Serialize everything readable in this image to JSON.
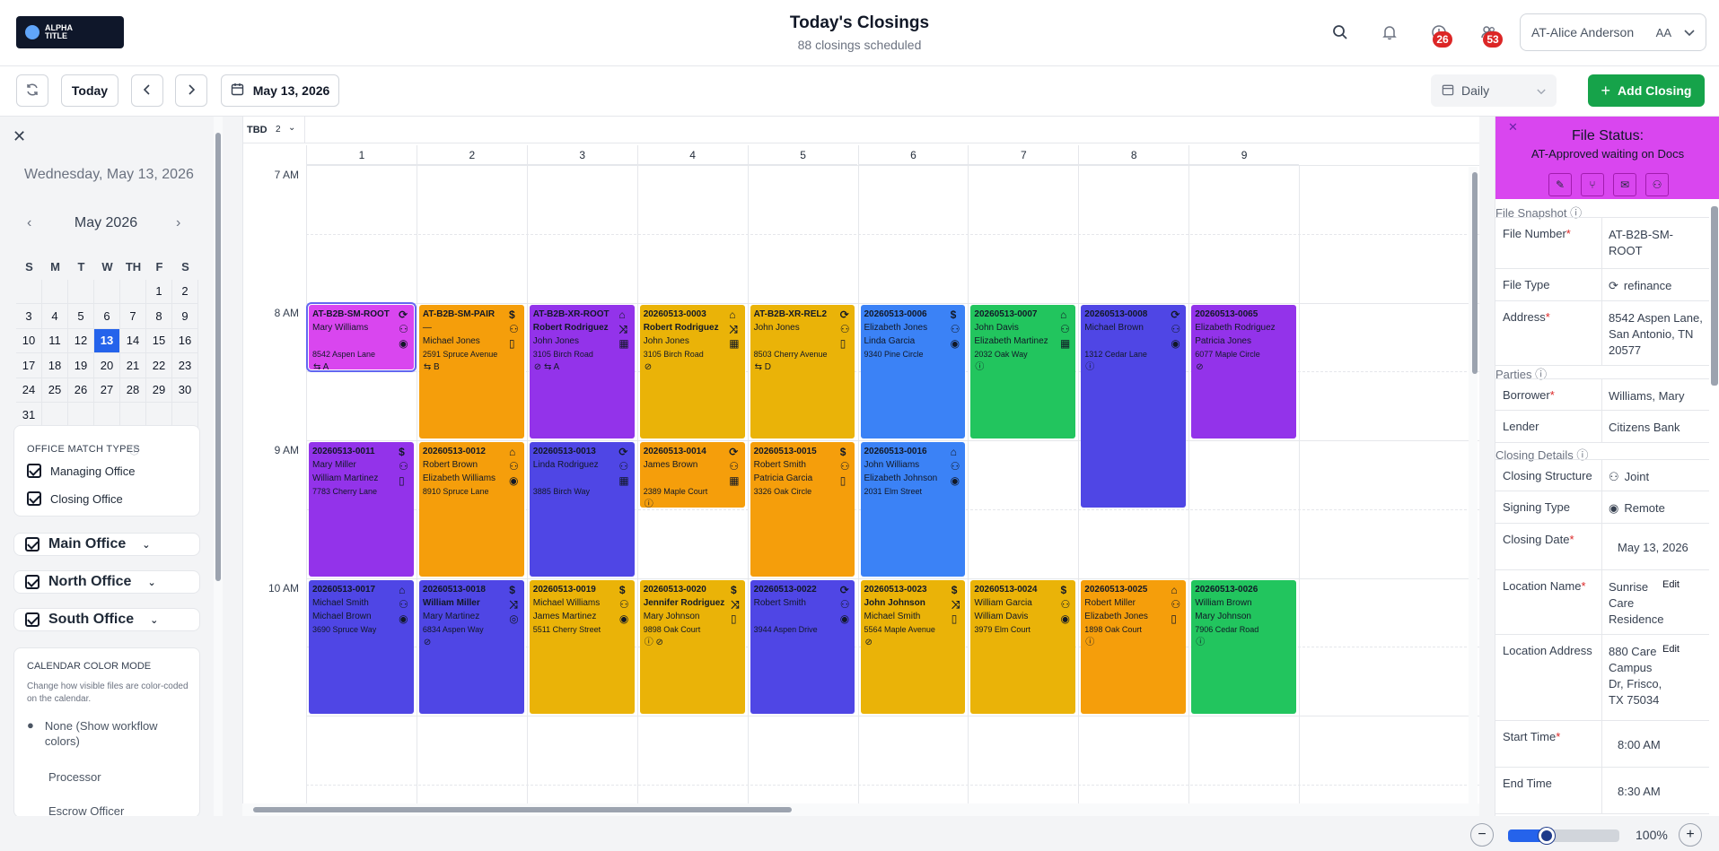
{
  "header": {
    "logo_line1": "ALPHA",
    "logo_line2": "TITLE",
    "title": "Today's Closings",
    "subtitle": "88 closings scheduled",
    "badge_1": "26",
    "badge_2": "53",
    "user_name": "AT-Alice Anderson",
    "user_initials": "AA"
  },
  "toolbar": {
    "today_label": "Today",
    "date_label": "May 13, 2026",
    "view_label": "Daily",
    "add_label": "Add Closing"
  },
  "sidebar": {
    "long_date": "Wednesday, May 13, 2026",
    "month_label": "May 2026",
    "weekdays": [
      "S",
      "M",
      "T",
      "W",
      "TH",
      "F",
      "S"
    ],
    "days": [
      "",
      "",
      "",
      "",
      "",
      "1",
      "2",
      "3",
      "4",
      "5",
      "6",
      "7",
      "8",
      "9",
      "10",
      "11",
      "12",
      "13",
      "14",
      "15",
      "16",
      "17",
      "18",
      "19",
      "20",
      "21",
      "22",
      "23",
      "24",
      "25",
      "26",
      "27",
      "28",
      "29",
      "30",
      "31",
      "",
      "",
      "",
      "",
      "",
      ""
    ],
    "selected_day": "13",
    "match_title": "OFFICE MATCH TYPES",
    "match_1": "Managing Office",
    "match_2": "Closing Office",
    "office_1": "Main Office",
    "office_2": "North Office",
    "office_3": "South Office",
    "color_title": "CALENDAR COLOR MODE",
    "color_desc": "Change how visible files are color-coded on the calendar.",
    "color_opt_1": "None (Show workflow colors)",
    "color_opt_2": "Processor",
    "color_opt_3": "Escrow Officer"
  },
  "calendar": {
    "tbd_label": "TBD",
    "tbd_count": "2",
    "columns": [
      "1",
      "2",
      "3",
      "4",
      "5",
      "6",
      "7",
      "8",
      "9"
    ],
    "times": [
      "7 AM",
      "8 AM",
      "9 AM",
      "10 AM"
    ],
    "events": [
      {
        "col": 0,
        "row": 0,
        "span": 1,
        "color": "#d946ef",
        "selected": true,
        "file": "AT-B2B-SM-ROOT",
        "l1": "Mary Williams",
        "l2": "",
        "addr": "8542 Aspen Lane",
        "foot": "⇆ A",
        "icons": [
          "⟳",
          "⚇",
          "◉"
        ],
        "bold1": false
      },
      {
        "col": 1,
        "row": 0,
        "span": 2,
        "color": "#f59e0b",
        "file": "AT-B2B-SM-PAIR",
        "l1": "—",
        "l2": "Michael Jones",
        "addr": "2591 Spruce Avenue",
        "foot": "⇆ B",
        "icons": [
          "$",
          "⚇",
          "▯"
        ]
      },
      {
        "col": 2,
        "row": 0,
        "span": 2,
        "color": "#9333ea",
        "file": "AT-B2B-XR-ROOT",
        "l1": "Robert Rodriguez",
        "l2": "John Jones",
        "addr": "3105 Birch Road",
        "foot": "⊘ ⇆ A",
        "icons": [
          "⌂",
          "⤨",
          "▦"
        ],
        "bold1": true
      },
      {
        "col": 3,
        "row": 0,
        "span": 2,
        "color": "#eab308",
        "file": "20260513-0003",
        "l1": "Robert Rodriguez",
        "l2": "John Jones",
        "addr": "3105 Birch Road",
        "foot": "⊘",
        "icons": [
          "⌂",
          "⤨",
          "▦"
        ],
        "bold1": true
      },
      {
        "col": 4,
        "row": 0,
        "span": 2,
        "color": "#eab308",
        "file": "AT-B2B-XR-REL2",
        "l1": "John Jones",
        "l2": "",
        "addr": "8503 Cherry Avenue",
        "foot": "⇆ D",
        "icons": [
          "⟳",
          "⚇",
          "▯"
        ]
      },
      {
        "col": 5,
        "row": 0,
        "span": 2,
        "color": "#3b82f6",
        "file": "20260513-0006",
        "l1": "Elizabeth Jones",
        "l2": "Linda Garcia",
        "addr": "9340 Pine Circle",
        "foot": "",
        "icons": [
          "$",
          "⚇",
          "◉"
        ]
      },
      {
        "col": 6,
        "row": 0,
        "span": 2,
        "color": "#22c55e",
        "file": "20260513-0007",
        "l1": "John Davis",
        "l2": "Elizabeth Martinez",
        "addr": "2032 Oak Way",
        "foot": "ⓘ",
        "icons": [
          "⌂",
          "⚇",
          "▦"
        ]
      },
      {
        "col": 7,
        "row": 0,
        "span": 3,
        "color": "#4f46e5",
        "file": "20260513-0008",
        "l1": "Michael Brown",
        "l2": "",
        "addr": "1312 Cedar Lane",
        "foot": "ⓘ",
        "icons": [
          "⟳",
          "⚇",
          "◉"
        ]
      },
      {
        "col": 8,
        "row": 0,
        "span": 2,
        "color": "#9333ea",
        "file": "20260513-0065",
        "l1": "Elizabeth Rodriguez",
        "l2": "Patricia Jones",
        "addr": "6077 Maple Circle",
        "foot": "⊘",
        "icons": []
      },
      {
        "col": 0,
        "row": 1,
        "span": 2,
        "color": "#9333ea",
        "file": "20260513-0011",
        "l1": "Mary Miller",
        "l2": "William Martinez",
        "addr": "7783 Cherry Lane",
        "foot": "",
        "icons": [
          "$",
          "⚇",
          "▯"
        ]
      },
      {
        "col": 1,
        "row": 1,
        "span": 2,
        "color": "#f59e0b",
        "file": "20260513-0012",
        "l1": "Robert Brown",
        "l2": "Elizabeth Williams",
        "addr": "8910 Spruce Lane",
        "foot": "",
        "icons": [
          "⌂",
          "⚇",
          "◉"
        ]
      },
      {
        "col": 2,
        "row": 1,
        "span": 2,
        "color": "#4f46e5",
        "file": "20260513-0013",
        "l1": "Linda Rodriguez",
        "l2": "",
        "addr": "3885 Birch Way",
        "foot": "",
        "icons": [
          "⟳",
          "⚇",
          "▦"
        ]
      },
      {
        "col": 3,
        "row": 1,
        "span": 1,
        "color": "#f59e0b",
        "file": "20260513-0014",
        "l1": "James Brown",
        "l2": "",
        "addr": "2389 Maple Court",
        "foot": "ⓘ",
        "icons": [
          "⟳",
          "⚇",
          "▦"
        ]
      },
      {
        "col": 4,
        "row": 1,
        "span": 2,
        "color": "#f59e0b",
        "file": "20260513-0015",
        "l1": "Robert Smith",
        "l2": "Patricia Garcia",
        "addr": "3326 Oak Circle",
        "foot": "",
        "icons": [
          "$",
          "⚇",
          "▯"
        ]
      },
      {
        "col": 5,
        "row": 1,
        "span": 2,
        "color": "#3b82f6",
        "file": "20260513-0016",
        "l1": "John Williams",
        "l2": "Elizabeth Johnson",
        "addr": "2031 Elm Street",
        "foot": "",
        "icons": [
          "⌂",
          "⚇",
          "◉"
        ]
      },
      {
        "col": 0,
        "row": 2,
        "span": 2,
        "color": "#4f46e5",
        "file": "20260513-0017",
        "l1": "Michael Smith",
        "l2": "Michael Brown",
        "addr": "3690 Spruce Way",
        "foot": "",
        "icons": [
          "⌂",
          "⚇",
          "◉"
        ]
      },
      {
        "col": 1,
        "row": 2,
        "span": 2,
        "color": "#4f46e5",
        "file": "20260513-0018",
        "l1": "William Miller",
        "l2": "Mary Martinez",
        "addr": "6834 Aspen Way",
        "foot": "⊘",
        "icons": [
          "$",
          "⤨",
          "◎"
        ],
        "bold1": true
      },
      {
        "col": 2,
        "row": 2,
        "span": 2,
        "color": "#eab308",
        "file": "20260513-0019",
        "l1": "Michael Williams",
        "l2": "James Martinez",
        "addr": "5511 Cherry Street",
        "foot": "",
        "icons": [
          "$",
          "⚇",
          "◉"
        ]
      },
      {
        "col": 3,
        "row": 2,
        "span": 2,
        "color": "#eab308",
        "file": "20260513-0020",
        "l1": "Jennifer Rodriguez",
        "l2": "Mary Johnson",
        "addr": "9898 Oak Court",
        "foot": "ⓘ ⊘",
        "icons": [
          "$",
          "⤨",
          "▯"
        ],
        "bold1": true
      },
      {
        "col": 4,
        "row": 2,
        "span": 2,
        "color": "#4f46e5",
        "file": "20260513-0022",
        "l1": "Robert Smith",
        "l2": "",
        "addr": "3944 Aspen Drive",
        "foot": "",
        "icons": [
          "⟳",
          "⚇",
          "◉"
        ]
      },
      {
        "col": 5,
        "row": 2,
        "span": 2,
        "color": "#eab308",
        "file": "20260513-0023",
        "l1": "John Johnson",
        "l2": "Michael Smith",
        "addr": "5564 Maple Avenue",
        "foot": "⊘",
        "icons": [
          "$",
          "⤨",
          "▯"
        ],
        "bold1": true
      },
      {
        "col": 6,
        "row": 2,
        "span": 2,
        "color": "#eab308",
        "file": "20260513-0024",
        "l1": "William Garcia",
        "l2": "William Davis",
        "addr": "3979 Elm Court",
        "foot": "",
        "icons": [
          "$",
          "⚇",
          "◉"
        ]
      },
      {
        "col": 7,
        "row": 2,
        "span": 2,
        "color": "#f59e0b",
        "file": "20260513-0025",
        "l1": "Robert Miller",
        "l2": "Elizabeth Jones",
        "addr": "1898 Oak Court",
        "foot": "ⓘ",
        "icons": [
          "⌂",
          "⚇",
          "▯"
        ]
      },
      {
        "col": 8,
        "row": 2,
        "span": 2,
        "color": "#22c55e",
        "file": "20260513-0026",
        "l1": "William Brown",
        "l2": "Mary Johnson",
        "addr": "7906 Cedar Road",
        "foot": "ⓘ",
        "icons": []
      }
    ]
  },
  "file_status": {
    "title": "File Status:",
    "value": "AT-Approved waiting on Docs",
    "snapshot_label": "File Snapshot",
    "parties_label": "Parties",
    "closing_label": "Closing Details",
    "file_number_label": "File Number",
    "file_number": "AT-B2B-SM-ROOT",
    "file_type_label": "File Type",
    "file_type": "refinance",
    "address_label": "Address",
    "address": "8542 Aspen Lane, San Antonio, TN 20577",
    "borrower_label": "Borrower",
    "borrower": "Williams, Mary",
    "lender_label": "Lender",
    "lender": "Citizens Bank",
    "structure_label": "Closing Structure",
    "structure": "Joint",
    "signing_label": "Signing Type",
    "signing": "Remote",
    "closing_date_label": "Closing Date",
    "closing_date": "May 13, 2026",
    "location_name_label": "Location Name",
    "location_name": "Sunrise Care Residence",
    "location_address_label": "Location Address",
    "location_address": "880 Care Campus Dr, Frisco, TX 75034",
    "start_label": "Start Time",
    "start": "8:00 AM",
    "end_label": "End Time",
    "end": "8:30 AM",
    "edit_label": "Edit"
  },
  "footer": {
    "zoom": "100%",
    "zoom_level": 0.35
  }
}
